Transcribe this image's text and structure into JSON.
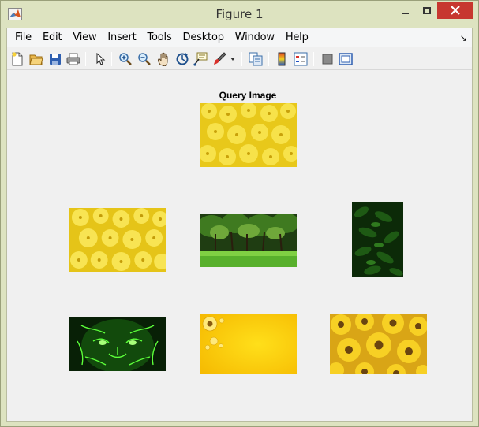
{
  "window": {
    "title": "Figure 1"
  },
  "menubar": {
    "items": [
      "File",
      "Edit",
      "View",
      "Insert",
      "Tools",
      "Desktop",
      "Window",
      "Help"
    ],
    "dock_glyph": "↘"
  },
  "toolbar": {
    "icons": [
      "new-figure-icon",
      "open-file-icon",
      "save-icon",
      "print-icon",
      "select-arrow-icon",
      "zoom-in-icon",
      "zoom-out-icon",
      "pan-hand-icon",
      "rotate-3d-icon",
      "data-cursor-icon",
      "brush-icon",
      "link-plot-icon",
      "colorbar-icon",
      "legend-icon",
      "hide-plot-tools-icon",
      "show-plot-tools-icon"
    ]
  },
  "figure": {
    "query_title": "Query Image",
    "images": [
      {
        "role": "query",
        "content": "yellow chrysanthemum flowers"
      },
      {
        "role": "result",
        "content": "yellow chrysanthemum flowers"
      },
      {
        "role": "result",
        "content": "green forest trees over grass"
      },
      {
        "role": "result",
        "content": "dark green fern leaves"
      },
      {
        "role": "result",
        "content": "neon green leopard face"
      },
      {
        "role": "result",
        "content": "yellow background with sunflowers"
      },
      {
        "role": "result",
        "content": "yellow sunflowers"
      }
    ]
  },
  "colors": {
    "titlebar": "#dde3c0",
    "close_button": "#c7372f",
    "client_background": "#f0f0f0"
  }
}
